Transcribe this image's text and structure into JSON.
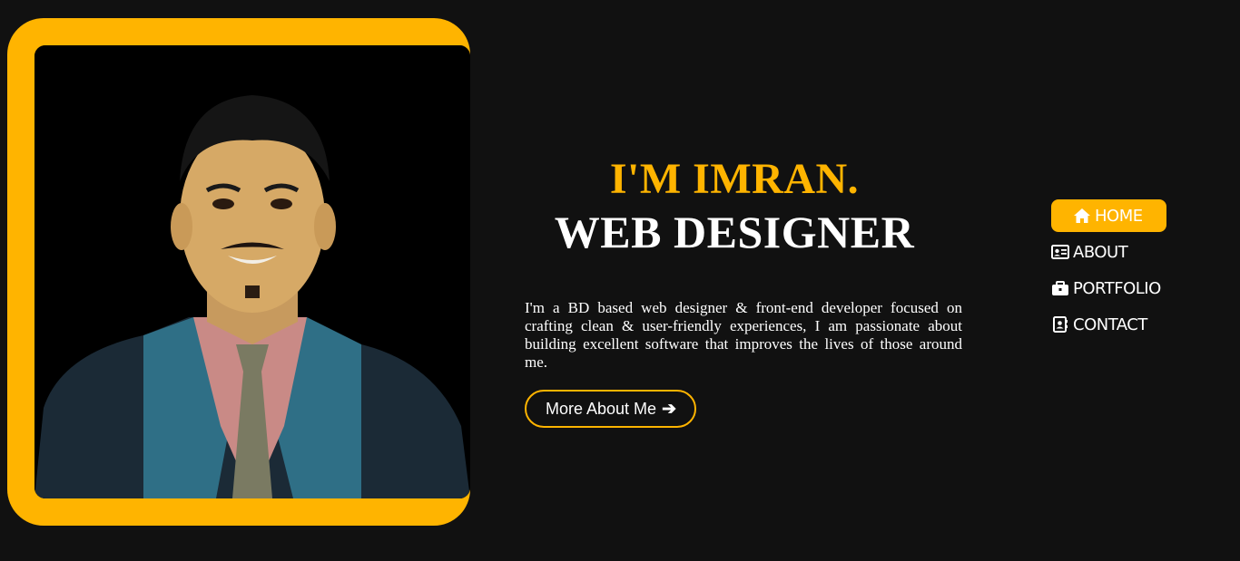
{
  "hero": {
    "name": "I'M IMRAN.",
    "role": "WEB DESIGNER",
    "bio": "I'm a BD based web designer & front-end developer focused on crafting clean & user-friendly experiences, I am passionate about building excellent software that improves the lives of those around me.",
    "cta_label": "More About Me",
    "cta_icon": "arrow-right-icon"
  },
  "nav": {
    "items": [
      {
        "label": "HOME",
        "icon": "home-icon",
        "active": true
      },
      {
        "label": "ABOUT",
        "icon": "id-card-icon",
        "active": false
      },
      {
        "label": "PORTFOLIO",
        "icon": "briefcase-icon",
        "active": false
      },
      {
        "label": "CONTACT",
        "icon": "contact-book-icon",
        "active": false
      }
    ]
  },
  "colors": {
    "accent": "#ffb400",
    "background": "#111111",
    "text": "#ffffff"
  }
}
